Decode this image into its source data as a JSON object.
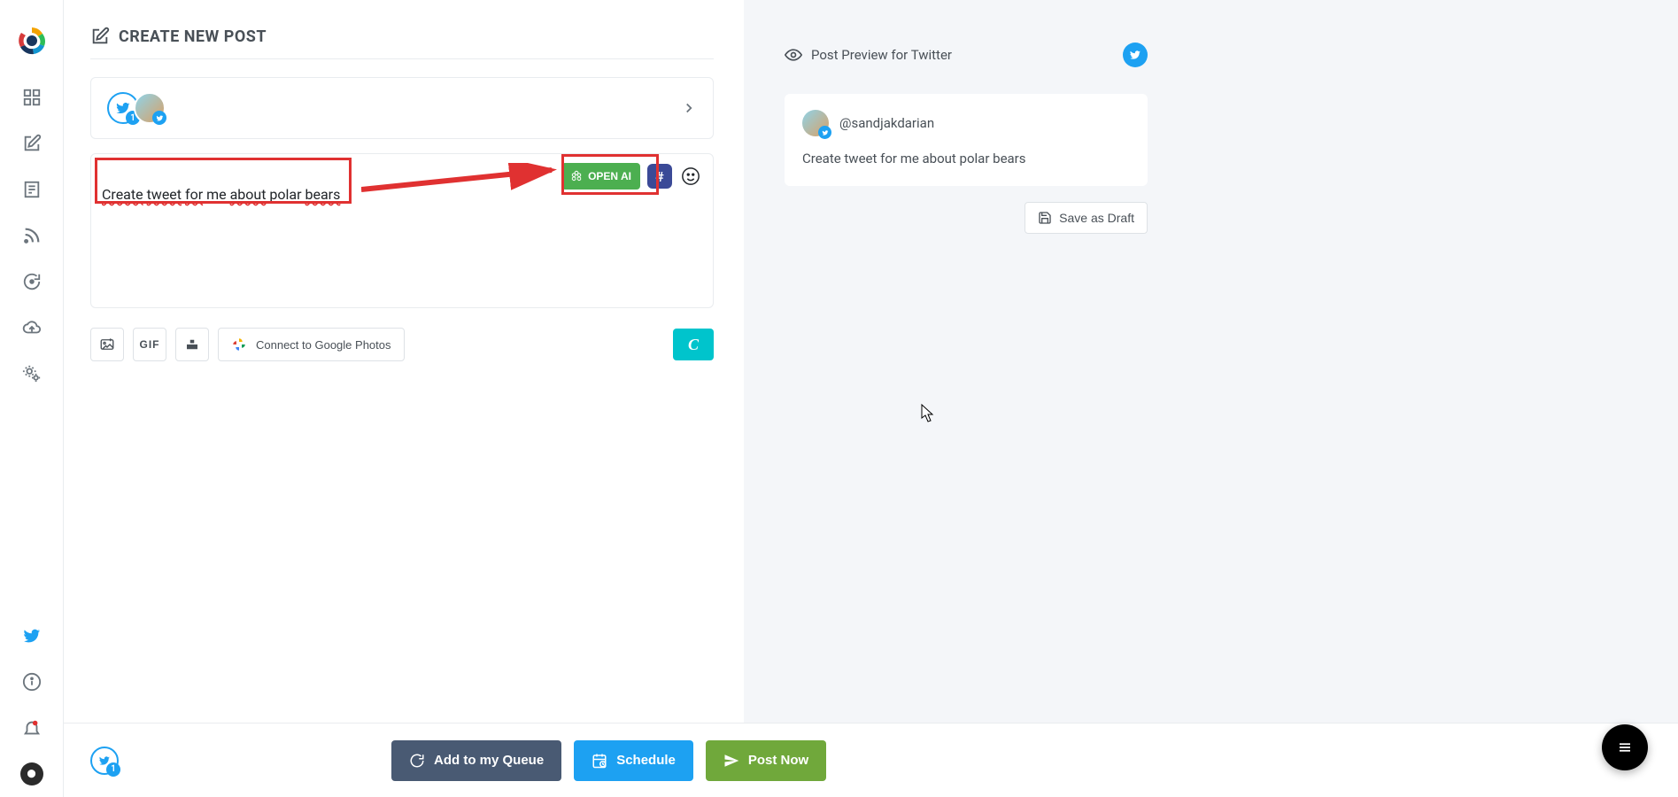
{
  "page": {
    "title": "CREATE NEW POST"
  },
  "account": {
    "badge": "1"
  },
  "composer": {
    "text_parts": [
      "Create",
      " ",
      "tweet",
      " ",
      "for",
      " me ",
      "about",
      " polar ",
      "bears"
    ],
    "text_plain": "Create tweet for me about polar bears"
  },
  "buttons": {
    "openai": "OPEN AI",
    "gif": "GIF",
    "google_photos": "Connect to Google Photos",
    "canva": "C",
    "add_queue": "Add to my Queue",
    "schedule": "Schedule",
    "post_now": "Post Now",
    "save_draft": "Save as Draft"
  },
  "preview": {
    "header": "Post Preview for Twitter",
    "handle": "@sandjakdarian",
    "body": "Create tweet for me about polar bears"
  },
  "footer": {
    "badge": "1"
  }
}
